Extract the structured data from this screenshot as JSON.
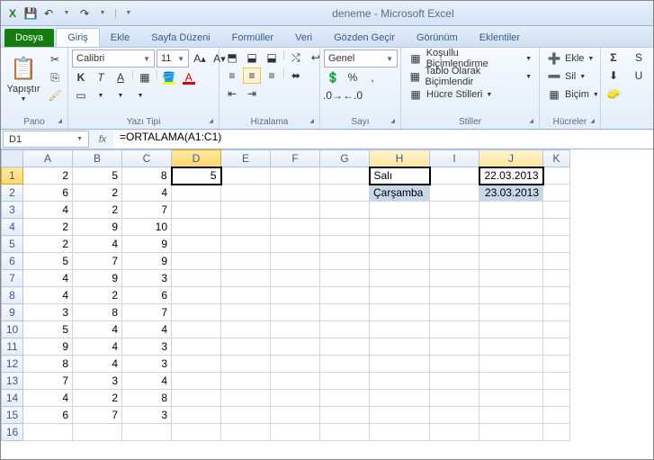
{
  "app": {
    "title": "deneme - Microsoft Excel"
  },
  "qat": {
    "excel": "X",
    "save": "💾",
    "undo": "↶",
    "redo": "↷"
  },
  "tabs": {
    "file": "Dosya",
    "home": "Giriş",
    "insert": "Ekle",
    "layout": "Sayfa Düzeni",
    "formulas": "Formüller",
    "data": "Veri",
    "review": "Gözden Geçir",
    "view": "Görünüm",
    "addins": "Eklentiler"
  },
  "ribbon": {
    "clipboard": {
      "paste": "Yapıştır",
      "title": "Pano"
    },
    "font": {
      "name": "Calibri",
      "size": "11",
      "title": "Yazı Tipi"
    },
    "align": {
      "title": "Hizalama"
    },
    "number": {
      "format": "Genel",
      "title": "Sayı"
    },
    "styles": {
      "cond": "Koşullu Biçimlendirme",
      "table": "Tablo Olarak Biçimlendir",
      "cell": "Hücre Stilleri",
      "title": "Stiller"
    },
    "cells": {
      "insert": "Ekle",
      "delete": "Sil",
      "format": "Biçim",
      "title": "Hücreler"
    },
    "editing": {
      "sigma": "Σ",
      "sort": "S",
      "find": "U"
    }
  },
  "fbar": {
    "name": "D1",
    "formula": "=ORTALAMA(A1:C1)"
  },
  "grid": {
    "cols": [
      "A",
      "B",
      "C",
      "D",
      "E",
      "F",
      "G",
      "H",
      "I",
      "J",
      "K"
    ],
    "rows": [
      "1",
      "2",
      "3",
      "4",
      "5",
      "6",
      "7",
      "8",
      "9",
      "10",
      "11",
      "12",
      "13",
      "14",
      "15",
      "16"
    ],
    "data": {
      "A": [
        "2",
        "6",
        "4",
        "2",
        "2",
        "5",
        "4",
        "4",
        "3",
        "5",
        "9",
        "8",
        "7",
        "4",
        "6"
      ],
      "B": [
        "5",
        "2",
        "2",
        "9",
        "4",
        "7",
        "9",
        "2",
        "8",
        "4",
        "4",
        "4",
        "3",
        "2",
        "7"
      ],
      "C": [
        "8",
        "4",
        "7",
        "10",
        "9",
        "9",
        "3",
        "6",
        "7",
        "4",
        "3",
        "3",
        "4",
        "8",
        "3"
      ],
      "D": [
        "5"
      ],
      "H": [
        "Salı",
        "Çarşamba"
      ],
      "J": [
        "22.03.2013",
        "23.03.2013"
      ]
    }
  },
  "chart_data": {
    "type": "table",
    "title": "deneme",
    "columns": [
      "A",
      "B",
      "C",
      "D",
      "H",
      "J"
    ],
    "rows": [
      [
        2,
        5,
        8,
        5,
        "Salı",
        "22.03.2013"
      ],
      [
        6,
        2,
        4,
        null,
        "Çarşamba",
        "23.03.2013"
      ],
      [
        4,
        2,
        7,
        null,
        null,
        null
      ],
      [
        2,
        9,
        10,
        null,
        null,
        null
      ],
      [
        2,
        4,
        9,
        null,
        null,
        null
      ],
      [
        5,
        7,
        9,
        null,
        null,
        null
      ],
      [
        4,
        9,
        3,
        null,
        null,
        null
      ],
      [
        4,
        2,
        6,
        null,
        null,
        null
      ],
      [
        3,
        8,
        7,
        null,
        null,
        null
      ],
      [
        5,
        4,
        4,
        null,
        null,
        null
      ],
      [
        9,
        4,
        3,
        null,
        null,
        null
      ],
      [
        8,
        4,
        3,
        null,
        null,
        null
      ],
      [
        7,
        3,
        4,
        null,
        null,
        null
      ],
      [
        4,
        2,
        8,
        null,
        null,
        null
      ],
      [
        6,
        7,
        3,
        null,
        null,
        null
      ]
    ],
    "formula_D1": "=ORTALAMA(A1:C1)"
  }
}
